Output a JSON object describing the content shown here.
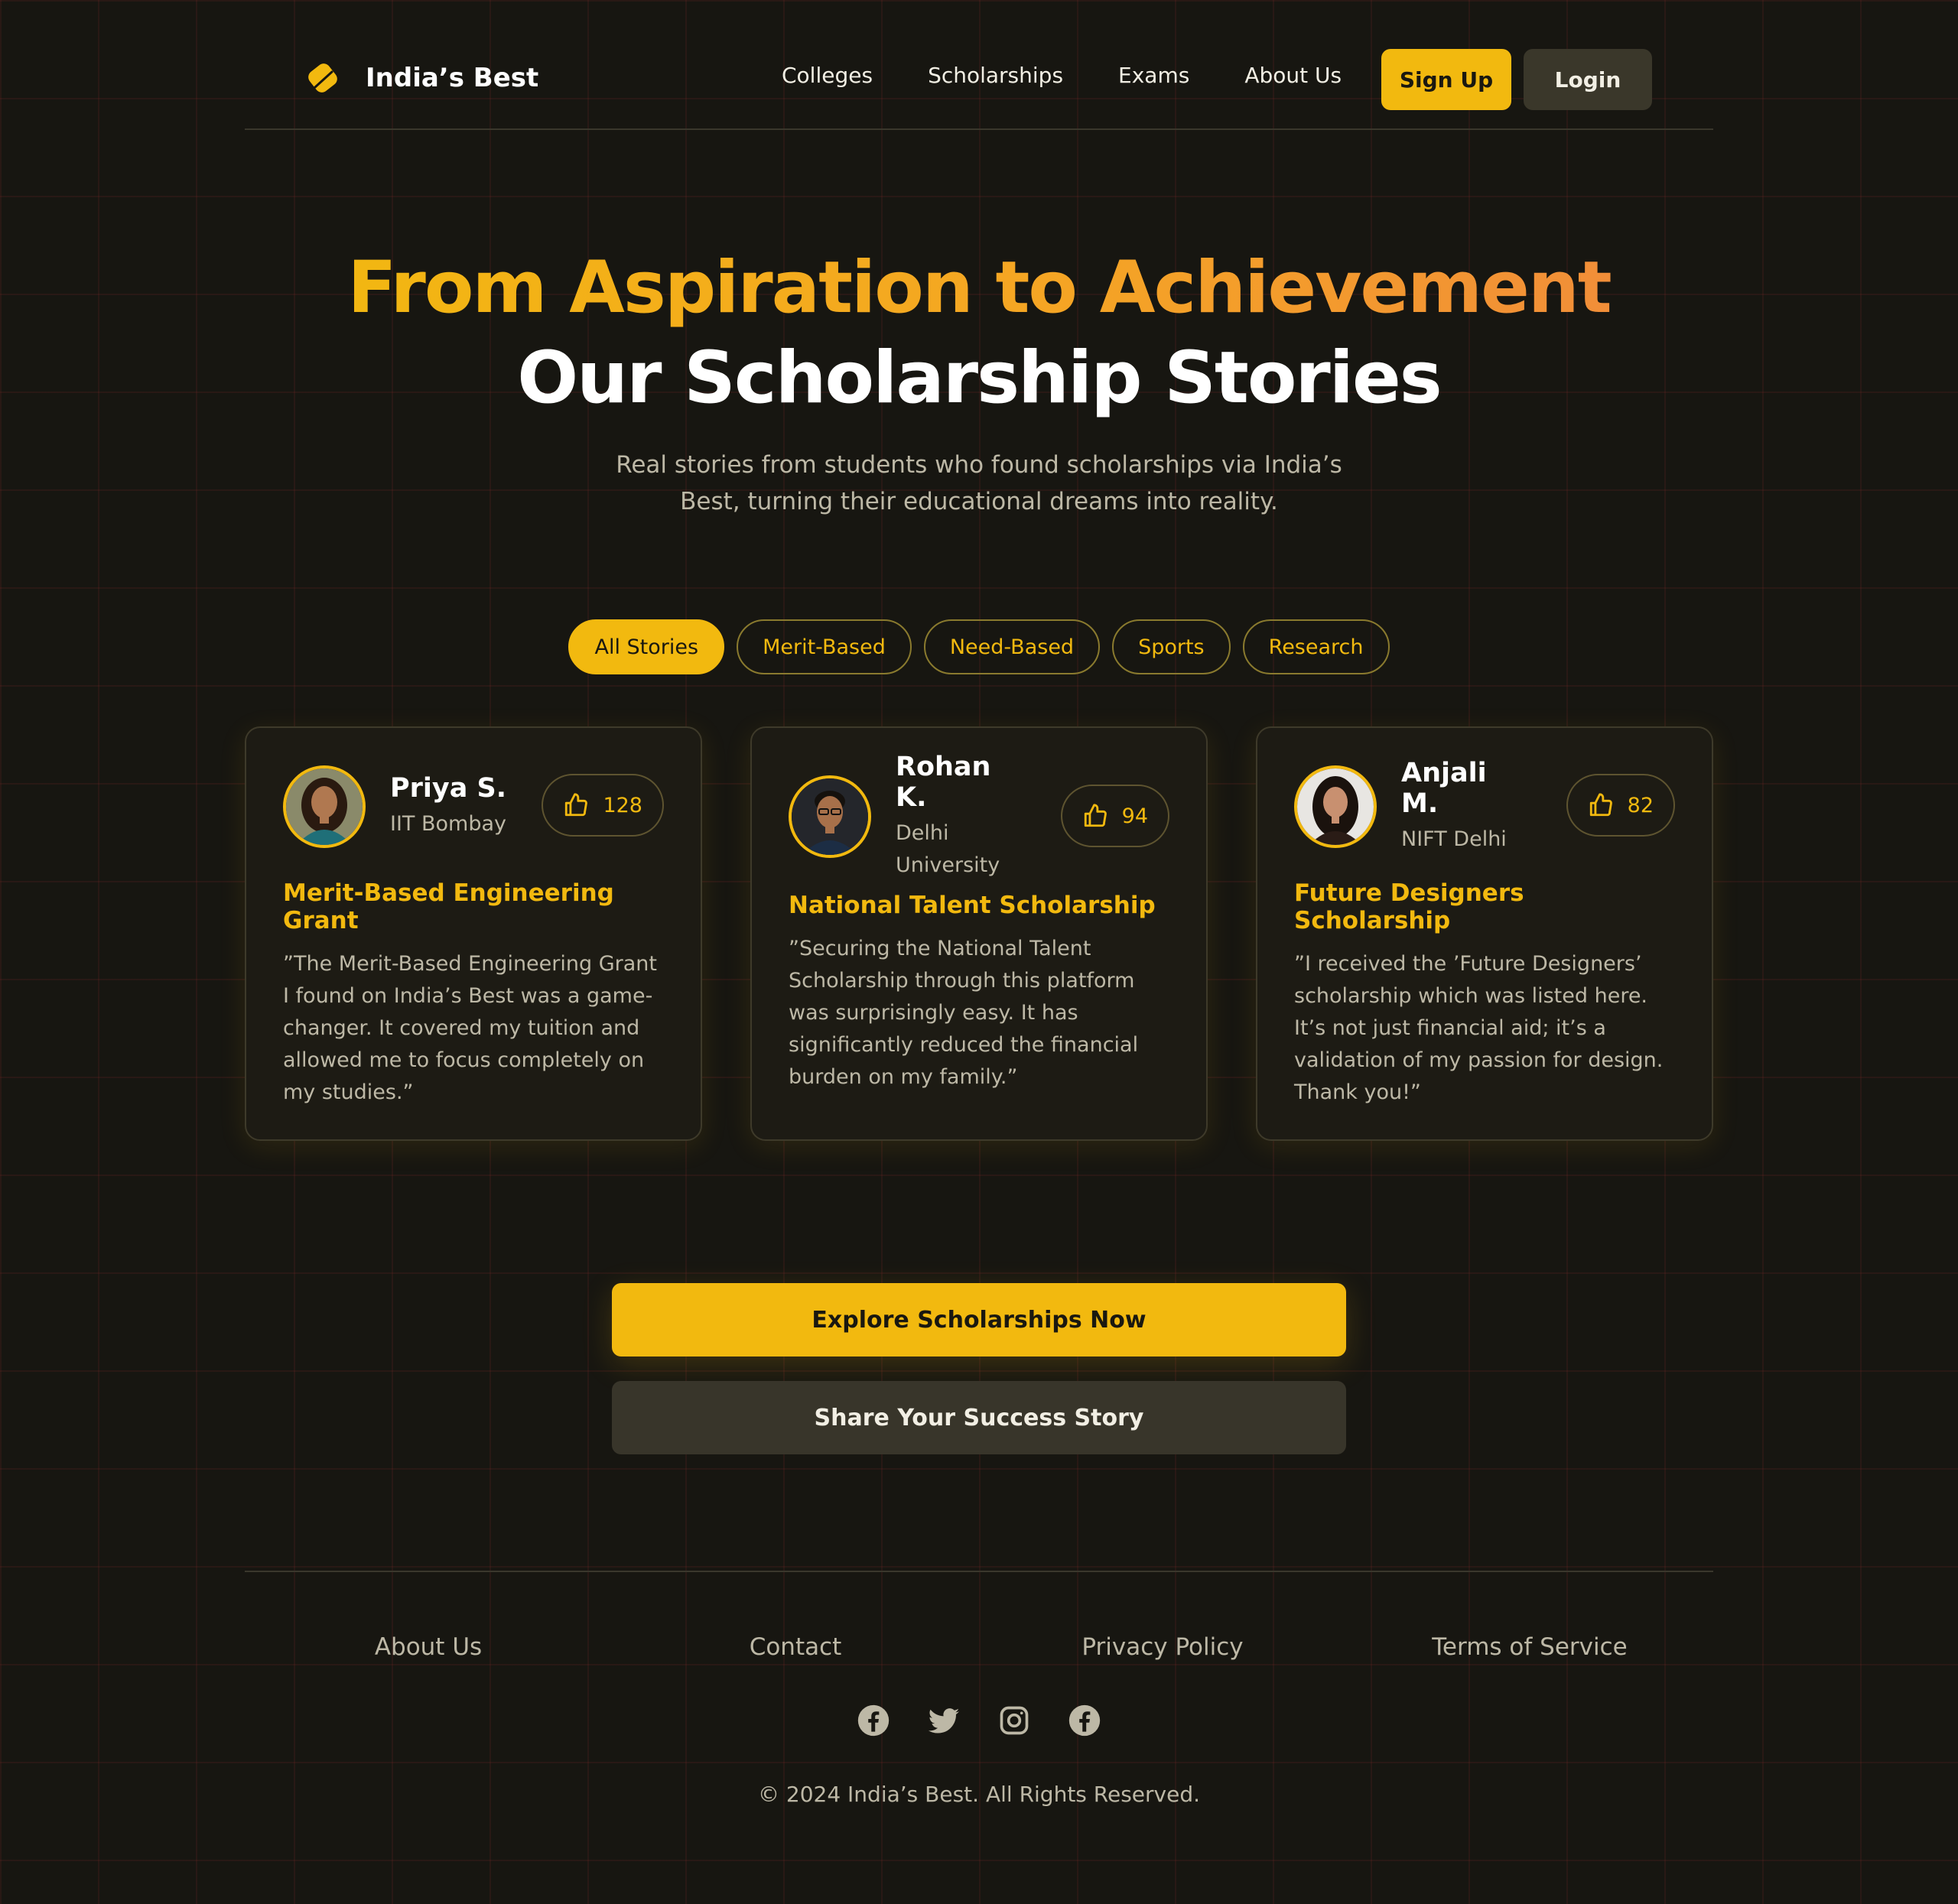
{
  "brand": {
    "name": "India’s Best",
    "logo_icon": "tag-logo-icon"
  },
  "nav": {
    "links": [
      "Colleges",
      "Scholarships",
      "Exams",
      "About Us"
    ],
    "signup_label": "Sign Up",
    "login_label": "Login"
  },
  "hero": {
    "title_line1": "From Aspiration to Achievement",
    "title_line2": "Our Scholarship Stories",
    "subtitle": "Real stories from students who found scholarships via India’s Best, turning their educational dreams into reality."
  },
  "filters": {
    "items": [
      "All Stories",
      "Merit-Based",
      "Need-Based",
      "Sports",
      "Research"
    ],
    "active": "All Stories"
  },
  "stories": [
    {
      "name": "Priya S.",
      "institution": "IIT Bombay",
      "likes": "128",
      "scholarship": "Merit-Based Engineering Grant",
      "quote": "”The Merit-Based Engineering Grant I found on India’s Best was a game-changer. It covered my tuition and allowed me to focus completely on my studies.”"
    },
    {
      "name": "Rohan K.",
      "institution": "Delhi University",
      "likes": "94",
      "scholarship": "National Talent Scholarship",
      "quote": "”Securing the National Talent Scholarship through this platform was surprisingly easy. It has significantly reduced the financial burden on my family.”"
    },
    {
      "name": "Anjali M.",
      "institution": "NIFT Delhi",
      "likes": "82",
      "scholarship": "Future Designers Scholarship",
      "quote": "”I received the ’Future Designers’ scholarship which was listed here. It’s not just financial aid; it’s a validation of my passion for design. Thank you!”"
    }
  ],
  "cta": {
    "primary_label": "Explore Scholarships Now",
    "secondary_label": "Share Your Success Story"
  },
  "footer": {
    "links": [
      "About Us",
      "Contact",
      "Privacy Policy",
      "Terms of Service"
    ],
    "socials": [
      "facebook-icon",
      "twitter-icon",
      "instagram-icon",
      "facebook-icon"
    ],
    "copyright": "© 2024 India’s Best. All Rights Reserved."
  },
  "colors": {
    "accent": "#f2b90f",
    "background": "#171611",
    "card": "#1d1b14",
    "muted_text": "#bdb8a6"
  }
}
